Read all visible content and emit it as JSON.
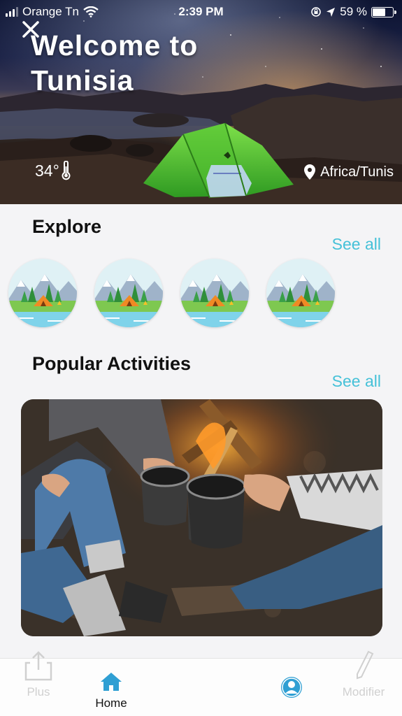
{
  "status_bar": {
    "carrier": "Orange Tn",
    "time": "2:39 PM",
    "battery": "59 %"
  },
  "hero": {
    "title": "Welcome to Tunisia",
    "temperature": "34°",
    "location": "Africa/Tunis"
  },
  "explore": {
    "title": "Explore",
    "see_all": "See all",
    "items": [
      {
        "icon": "camping-scene-icon"
      },
      {
        "icon": "camping-scene-icon"
      },
      {
        "icon": "camping-scene-icon"
      },
      {
        "icon": "camping-scene-icon"
      }
    ]
  },
  "popular": {
    "title": "Popular Activities",
    "see_all": "See all"
  },
  "tabbar": {
    "plus": "Plus",
    "home": "Home",
    "modifier": "Modifier"
  },
  "colors": {
    "accent": "#45c1d8",
    "tab_active": "#2f9fd3",
    "tab_inactive": "#c9c9c9"
  }
}
